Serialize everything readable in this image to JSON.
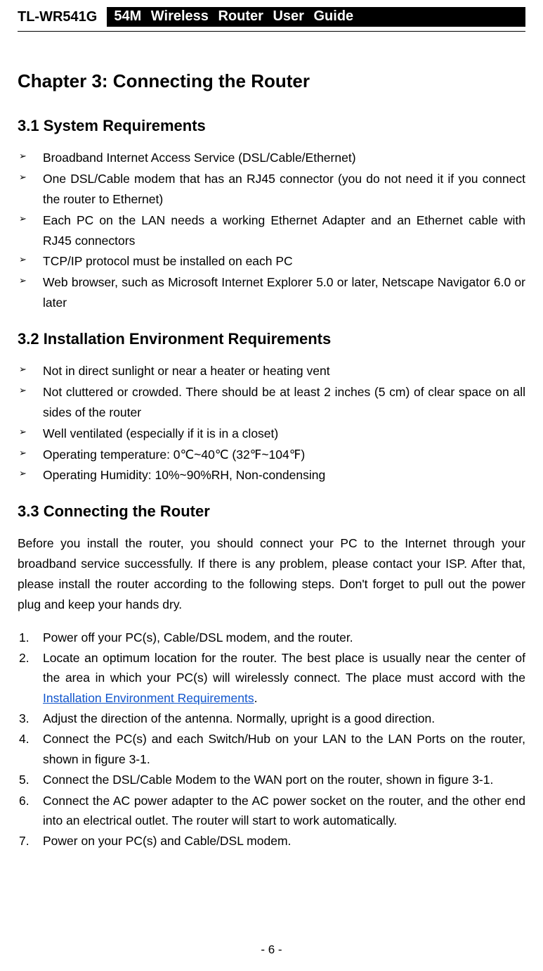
{
  "header": {
    "model": "TL-WR541G",
    "title": "54M Wireless Router User Guide"
  },
  "chapter_title": "Chapter 3: Connecting the Router",
  "section_31": {
    "title": "3.1 System Requirements",
    "items": [
      "Broadband Internet Access Service (DSL/Cable/Ethernet)",
      "One DSL/Cable modem that has an RJ45 connector (you do not need it if you connect the router to Ethernet)",
      "Each PC on the LAN needs a working Ethernet Adapter and an Ethernet cable with RJ45 connectors",
      "TCP/IP protocol must be installed on each PC",
      "Web browser, such as Microsoft Internet Explorer 5.0 or later, Netscape Navigator 6.0 or later"
    ]
  },
  "section_32": {
    "title": "3.2 Installation Environment Requirements",
    "items": [
      "Not in direct sunlight or near a heater or heating vent",
      "Not cluttered or crowded. There should be at least 2 inches (5 cm) of clear space on all sides of the router",
      "Well ventilated (especially if it is in a closet)",
      "Operating temperature: 0℃~40℃ (32℉~104℉)",
      "Operating Humidity: 10%~90%RH, Non-condensing"
    ]
  },
  "section_33": {
    "title": "3.3 Connecting the Router",
    "intro": "Before you install the router, you should connect your PC to the Internet through your broadband service successfully. If there is any problem, please contact your ISP. After that, please install the router according to the following steps. Don't forget to pull out the power plug and keep your hands dry.",
    "steps": {
      "s1": "Power off your PC(s), Cable/DSL modem, and the router.",
      "s2_before": "Locate an optimum location for the router. The best place is usually near the center of the area in which your PC(s) will wirelessly connect. The place must accord with the ",
      "s2_link": "Installation Environment Requirements",
      "s2_after": ".",
      "s3": "Adjust the direction of the antenna. Normally, upright is a good direction.",
      "s4": "Connect the PC(s) and each Switch/Hub on your LAN to the LAN Ports on the router, shown in figure 3-1.",
      "s5": "Connect the DSL/Cable Modem to the WAN port on the router, shown in figure 3-1.",
      "s6": "Connect the AC power adapter to the AC power socket on the router, and the other end into an electrical outlet. The router will start to work automatically.",
      "s7": "Power on your PC(s) and Cable/DSL modem."
    }
  },
  "page_number": "- 6 -"
}
